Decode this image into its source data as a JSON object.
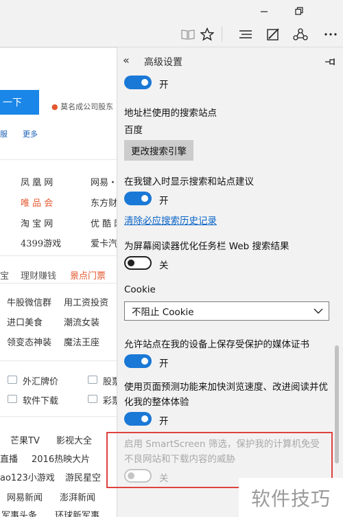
{
  "window": {
    "minimize_icon": "minimize-icon",
    "restore_icon": "restore-icon"
  },
  "toolbar": {
    "icons": [
      "reading-view-icon",
      "favorite-star-icon",
      "hub-icon",
      "web-note-icon",
      "share-icon"
    ]
  },
  "page": {
    "primary_button": "一下",
    "news": "莫名成公司股东",
    "nav_a": "服",
    "nav_b": "更多",
    "sites": [
      [
        "凤 凰 网",
        "网易・"
      ],
      [
        "唯 品 会",
        "东方财"
      ],
      [
        "淘 宝 网",
        "优 酷 网"
      ],
      [
        "4399游戏",
        "爱卡汽"
      ]
    ],
    "tabs": [
      "宝",
      "理财赚钱",
      "景点门票"
    ],
    "grid": [
      [
        "牛股微信群",
        "用工资投资"
      ],
      [
        "进口美食",
        "潮流女装"
      ],
      [
        "领变态神装",
        "魔法王座"
      ]
    ],
    "tools": [
      [
        "外汇牌价",
        "股票"
      ],
      [
        "软件下载",
        "彩票"
      ]
    ],
    "bottom": [
      [
        "芒果TV",
        "影视大全"
      ],
      [
        "直播",
        "2016热映大片"
      ],
      [
        "ao123小游戏",
        "游民星空"
      ],
      [
        "网易新闻",
        "澎湃新闻"
      ],
      [
        "军事头条",
        "环球新军事"
      ]
    ]
  },
  "panel": {
    "title": "高级设置",
    "top_toggle_state": "开",
    "search_engine_label": "地址栏使用的搜索站点",
    "search_engine_value": "百度",
    "change_engine_button": "更改搜索引擎",
    "suggest_label": "在我键入时显示搜索和站点建议",
    "suggest_state": "开",
    "clear_history_link": "清除必应搜索历史记录",
    "taskbar_label": "为屏幕阅读器优化任务栏 Web 搜索结果",
    "taskbar_state": "关",
    "cookie_label": "Cookie",
    "cookie_value": "不阻止 Cookie",
    "media_license_label": "允许站点在我的设备上保存受保护的媒体证书",
    "media_license_state": "开",
    "predict_label": "使用页面预测功能来加快浏览速度、改进阅读并优化我的整体体验",
    "predict_state": "开",
    "smartscreen_label": "启用 SmartScreen 筛选，保护我的计算机免受不良网站和下载内容的威胁",
    "smartscreen_state": "关"
  },
  "watermark": "软件技巧",
  "colors": {
    "accent": "#1a78d6",
    "link": "#0a64c8",
    "highlight_red": "#e04040",
    "page_orange": "#e4572e"
  }
}
